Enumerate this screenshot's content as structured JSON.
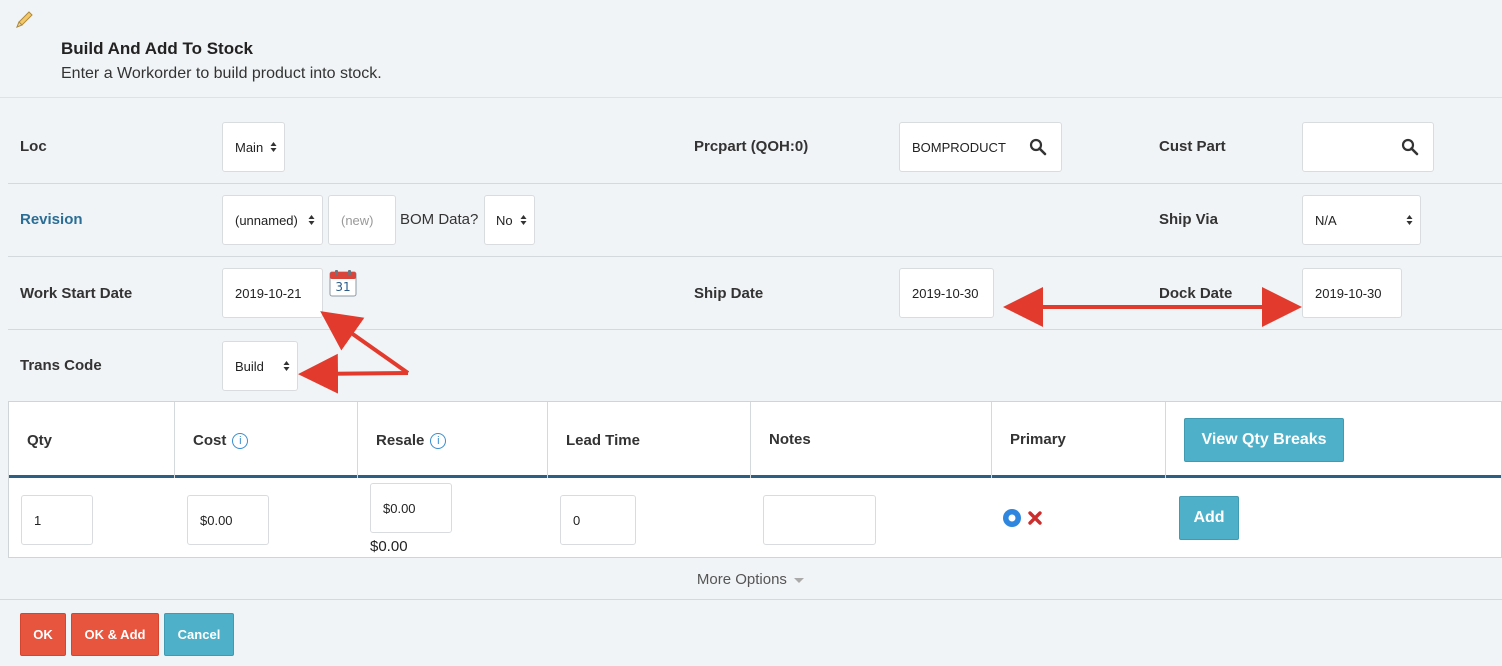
{
  "header": {
    "title": "Build And Add To Stock",
    "subtitle": "Enter a Workorder to build product into stock."
  },
  "form": {
    "loc": {
      "label": "Loc",
      "value": "Main"
    },
    "prcpart": {
      "label": "Prcpart (QOH:0)",
      "value": "BOMPRODUCT"
    },
    "cust_part": {
      "label": "Cust Part",
      "value": ""
    },
    "revision": {
      "label": "Revision",
      "value": "(unnamed)",
      "new_placeholder": "(new)"
    },
    "bom_data": {
      "label": "BOM Data?",
      "value": "No"
    },
    "ship_via": {
      "label": "Ship Via",
      "value": "N/A"
    },
    "work_start_date": {
      "label": "Work Start Date",
      "value": "2019-10-21"
    },
    "ship_date": {
      "label": "Ship Date",
      "value": "2019-10-30"
    },
    "dock_date": {
      "label": "Dock Date",
      "value": "2019-10-30"
    },
    "trans_code": {
      "label": "Trans Code",
      "value": "Build"
    },
    "calendar_day": "31"
  },
  "grid": {
    "columns": [
      "Qty",
      "Cost",
      "Resale",
      "Lead Time",
      "Notes",
      "Primary"
    ],
    "info_glyph": "i",
    "view_qty_breaks": "View Qty Breaks",
    "row": {
      "qty": "1",
      "cost": "$0.00",
      "resale": "$0.00",
      "resale_computed": "$0.00",
      "lead_time": "0",
      "notes": "",
      "add_label": "Add"
    }
  },
  "more_options": "More Options",
  "footer": {
    "ok": "OK",
    "ok_add": "OK & Add",
    "cancel": "Cancel"
  },
  "icons": [
    "pencil-icon",
    "spinner-icon",
    "search-icon",
    "calendar-icon",
    "info-icon",
    "radio-selected-icon",
    "remove-icon",
    "caret-down-icon"
  ],
  "colors": {
    "accent_teal": "#4eb1c9",
    "action_red": "#e8553e",
    "annotation_red": "#e23b2e",
    "link_blue": "#2a6e96",
    "header_border": "#2c5f82"
  }
}
